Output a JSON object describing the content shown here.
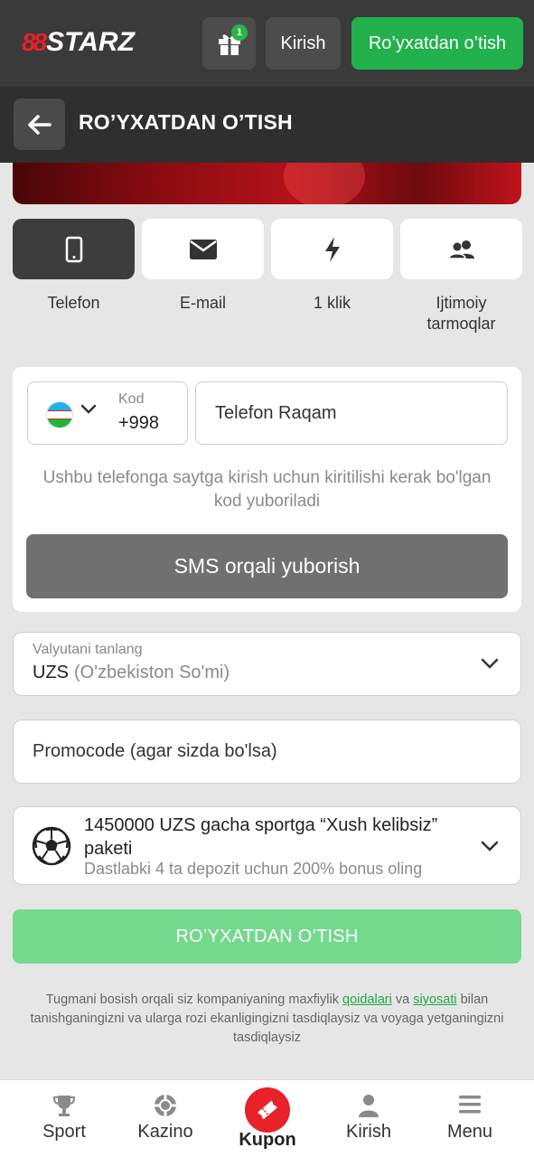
{
  "header": {
    "logo_prefix": "88",
    "logo_text": "STARZ",
    "gift_badge_count": "1",
    "login_label": "Kirish",
    "register_label": "Ro’yxatdan o’tish"
  },
  "titlebar": {
    "title": "RO’YXATDAN O’TISH"
  },
  "methods": [
    {
      "label": "Telefon",
      "icon": "phone-icon",
      "active": true
    },
    {
      "label": "E-mail",
      "icon": "envelope-icon",
      "active": false
    },
    {
      "label": "1 klik",
      "icon": "lightning-icon",
      "active": false
    },
    {
      "label": "Ijtimoiy tarmoqlar",
      "icon": "users-icon",
      "active": false
    }
  ],
  "phone_form": {
    "code_label": "Kod",
    "code_value": "+998",
    "phone_placeholder": "Telefon Raqam",
    "hint": "Ushbu telefonga saytga kirish uchun kiritilishi kerak bo'lgan kod yuboriladi",
    "sms_button": "SMS orqali yuborish"
  },
  "currency": {
    "label": "Valyutani tanlang",
    "code": "UZS",
    "name": "(O'zbekiston So'mi)"
  },
  "promo": {
    "placeholder": "Promocode (agar sizda bo'lsa)"
  },
  "bonus": {
    "title": "1450000 UZS gacha sportga “Xush kelibsiz” paketi",
    "subtitle": "Dastlabki 4 ta depozit uchun 200% bonus oling"
  },
  "submit_label": "RO’YXATDAN O’TISH",
  "legal": {
    "part1": "Tugmani bosish orqali siz kompaniyaning maxfiylik ",
    "link1": "qoidalari",
    "part2": " va ",
    "link2": "siyosati",
    "part3": " bilan tanishganingizni va ularga rozi ekanligingizni tasdiqlaysiz va voyaga yetganingizni tasdiqlaysiz"
  },
  "bottom_nav": {
    "sport": "Sport",
    "kazino": "Kazino",
    "kupon": "Kupon",
    "kirish": "Kirish",
    "menu": "Menu"
  },
  "colors": {
    "brand_green": "#22b14c",
    "brand_red": "#e8212a",
    "submit_disabled": "#74d98d"
  }
}
